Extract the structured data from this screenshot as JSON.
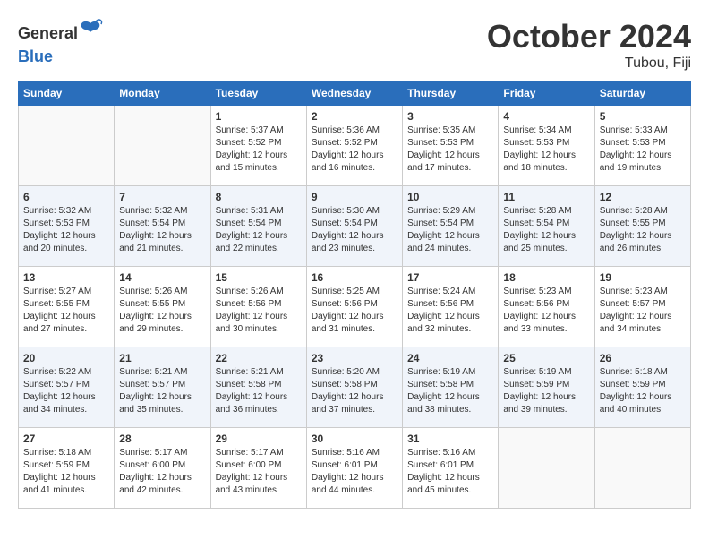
{
  "header": {
    "logo_general": "General",
    "logo_blue": "Blue",
    "month_title": "October 2024",
    "location": "Tubou, Fiji"
  },
  "days_of_week": [
    "Sunday",
    "Monday",
    "Tuesday",
    "Wednesday",
    "Thursday",
    "Friday",
    "Saturday"
  ],
  "weeks": [
    [
      {
        "day": "",
        "sunrise": "",
        "sunset": "",
        "daylight": ""
      },
      {
        "day": "",
        "sunrise": "",
        "sunset": "",
        "daylight": ""
      },
      {
        "day": "1",
        "sunrise": "Sunrise: 5:37 AM",
        "sunset": "Sunset: 5:52 PM",
        "daylight": "Daylight: 12 hours and 15 minutes."
      },
      {
        "day": "2",
        "sunrise": "Sunrise: 5:36 AM",
        "sunset": "Sunset: 5:52 PM",
        "daylight": "Daylight: 12 hours and 16 minutes."
      },
      {
        "day": "3",
        "sunrise": "Sunrise: 5:35 AM",
        "sunset": "Sunset: 5:53 PM",
        "daylight": "Daylight: 12 hours and 17 minutes."
      },
      {
        "day": "4",
        "sunrise": "Sunrise: 5:34 AM",
        "sunset": "Sunset: 5:53 PM",
        "daylight": "Daylight: 12 hours and 18 minutes."
      },
      {
        "day": "5",
        "sunrise": "Sunrise: 5:33 AM",
        "sunset": "Sunset: 5:53 PM",
        "daylight": "Daylight: 12 hours and 19 minutes."
      }
    ],
    [
      {
        "day": "6",
        "sunrise": "Sunrise: 5:32 AM",
        "sunset": "Sunset: 5:53 PM",
        "daylight": "Daylight: 12 hours and 20 minutes."
      },
      {
        "day": "7",
        "sunrise": "Sunrise: 5:32 AM",
        "sunset": "Sunset: 5:54 PM",
        "daylight": "Daylight: 12 hours and 21 minutes."
      },
      {
        "day": "8",
        "sunrise": "Sunrise: 5:31 AM",
        "sunset": "Sunset: 5:54 PM",
        "daylight": "Daylight: 12 hours and 22 minutes."
      },
      {
        "day": "9",
        "sunrise": "Sunrise: 5:30 AM",
        "sunset": "Sunset: 5:54 PM",
        "daylight": "Daylight: 12 hours and 23 minutes."
      },
      {
        "day": "10",
        "sunrise": "Sunrise: 5:29 AM",
        "sunset": "Sunset: 5:54 PM",
        "daylight": "Daylight: 12 hours and 24 minutes."
      },
      {
        "day": "11",
        "sunrise": "Sunrise: 5:28 AM",
        "sunset": "Sunset: 5:54 PM",
        "daylight": "Daylight: 12 hours and 25 minutes."
      },
      {
        "day": "12",
        "sunrise": "Sunrise: 5:28 AM",
        "sunset": "Sunset: 5:55 PM",
        "daylight": "Daylight: 12 hours and 26 minutes."
      }
    ],
    [
      {
        "day": "13",
        "sunrise": "Sunrise: 5:27 AM",
        "sunset": "Sunset: 5:55 PM",
        "daylight": "Daylight: 12 hours and 27 minutes."
      },
      {
        "day": "14",
        "sunrise": "Sunrise: 5:26 AM",
        "sunset": "Sunset: 5:55 PM",
        "daylight": "Daylight: 12 hours and 29 minutes."
      },
      {
        "day": "15",
        "sunrise": "Sunrise: 5:26 AM",
        "sunset": "Sunset: 5:56 PM",
        "daylight": "Daylight: 12 hours and 30 minutes."
      },
      {
        "day": "16",
        "sunrise": "Sunrise: 5:25 AM",
        "sunset": "Sunset: 5:56 PM",
        "daylight": "Daylight: 12 hours and 31 minutes."
      },
      {
        "day": "17",
        "sunrise": "Sunrise: 5:24 AM",
        "sunset": "Sunset: 5:56 PM",
        "daylight": "Daylight: 12 hours and 32 minutes."
      },
      {
        "day": "18",
        "sunrise": "Sunrise: 5:23 AM",
        "sunset": "Sunset: 5:56 PM",
        "daylight": "Daylight: 12 hours and 33 minutes."
      },
      {
        "day": "19",
        "sunrise": "Sunrise: 5:23 AM",
        "sunset": "Sunset: 5:57 PM",
        "daylight": "Daylight: 12 hours and 34 minutes."
      }
    ],
    [
      {
        "day": "20",
        "sunrise": "Sunrise: 5:22 AM",
        "sunset": "Sunset: 5:57 PM",
        "daylight": "Daylight: 12 hours and 34 minutes."
      },
      {
        "day": "21",
        "sunrise": "Sunrise: 5:21 AM",
        "sunset": "Sunset: 5:57 PM",
        "daylight": "Daylight: 12 hours and 35 minutes."
      },
      {
        "day": "22",
        "sunrise": "Sunrise: 5:21 AM",
        "sunset": "Sunset: 5:58 PM",
        "daylight": "Daylight: 12 hours and 36 minutes."
      },
      {
        "day": "23",
        "sunrise": "Sunrise: 5:20 AM",
        "sunset": "Sunset: 5:58 PM",
        "daylight": "Daylight: 12 hours and 37 minutes."
      },
      {
        "day": "24",
        "sunrise": "Sunrise: 5:19 AM",
        "sunset": "Sunset: 5:58 PM",
        "daylight": "Daylight: 12 hours and 38 minutes."
      },
      {
        "day": "25",
        "sunrise": "Sunrise: 5:19 AM",
        "sunset": "Sunset: 5:59 PM",
        "daylight": "Daylight: 12 hours and 39 minutes."
      },
      {
        "day": "26",
        "sunrise": "Sunrise: 5:18 AM",
        "sunset": "Sunset: 5:59 PM",
        "daylight": "Daylight: 12 hours and 40 minutes."
      }
    ],
    [
      {
        "day": "27",
        "sunrise": "Sunrise: 5:18 AM",
        "sunset": "Sunset: 5:59 PM",
        "daylight": "Daylight: 12 hours and 41 minutes."
      },
      {
        "day": "28",
        "sunrise": "Sunrise: 5:17 AM",
        "sunset": "Sunset: 6:00 PM",
        "daylight": "Daylight: 12 hours and 42 minutes."
      },
      {
        "day": "29",
        "sunrise": "Sunrise: 5:17 AM",
        "sunset": "Sunset: 6:00 PM",
        "daylight": "Daylight: 12 hours and 43 minutes."
      },
      {
        "day": "30",
        "sunrise": "Sunrise: 5:16 AM",
        "sunset": "Sunset: 6:01 PM",
        "daylight": "Daylight: 12 hours and 44 minutes."
      },
      {
        "day": "31",
        "sunrise": "Sunrise: 5:16 AM",
        "sunset": "Sunset: 6:01 PM",
        "daylight": "Daylight: 12 hours and 45 minutes."
      },
      {
        "day": "",
        "sunrise": "",
        "sunset": "",
        "daylight": ""
      },
      {
        "day": "",
        "sunrise": "",
        "sunset": "",
        "daylight": ""
      }
    ]
  ]
}
